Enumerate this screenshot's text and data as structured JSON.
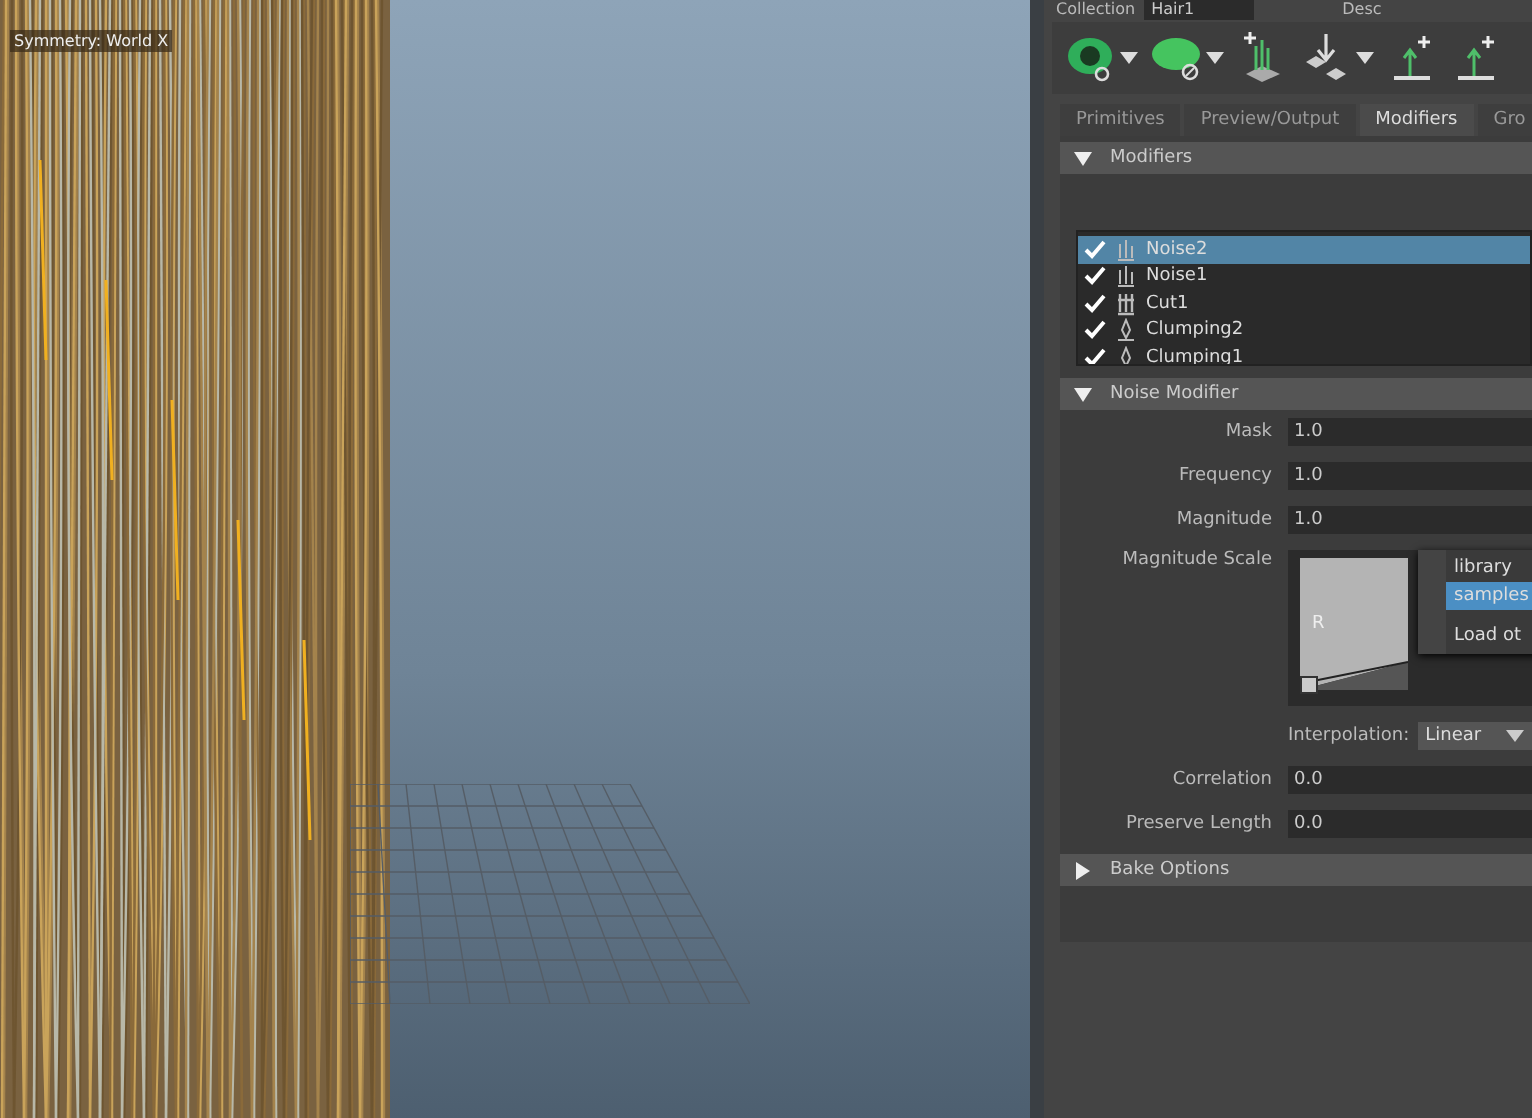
{
  "viewport": {
    "overlay_label": "Symmetry: World X"
  },
  "header": {
    "collection_label": "Collection",
    "collection_value": "Hair1",
    "description_label": "Desc"
  },
  "toolbar": {
    "tools": [
      {
        "kind": "eye",
        "dropdown": true
      },
      {
        "kind": "leaf",
        "dropdown": true
      },
      {
        "kind": "add-guides",
        "dropdown": false
      },
      {
        "kind": "move-guides",
        "dropdown": true
      },
      {
        "kind": "add-strand",
        "dropdown": false
      },
      {
        "kind": "add-strand",
        "dropdown": false
      }
    ]
  },
  "tabs": [
    {
      "label": "Primitives",
      "selected": false
    },
    {
      "label": "Preview/Output",
      "selected": false
    },
    {
      "label": "Modifiers",
      "selected": true
    },
    {
      "label": "Gro",
      "selected": false
    }
  ],
  "modifiers_section": {
    "title": "Modifiers",
    "expanded": true,
    "items": [
      {
        "label": "Noise2",
        "checked": true,
        "selected": true,
        "kind": "noise"
      },
      {
        "label": "Noise1",
        "checked": true,
        "selected": false,
        "kind": "noise"
      },
      {
        "label": "Cut1",
        "checked": true,
        "selected": false,
        "kind": "cut"
      },
      {
        "label": "Clumping2",
        "checked": true,
        "selected": false,
        "kind": "clump"
      },
      {
        "label": "Clumping1",
        "checked": true,
        "selected": false,
        "kind": "clump"
      }
    ]
  },
  "noise_section": {
    "title": "Noise Modifier",
    "expanded": true,
    "fields_top": [
      {
        "label": "Mask",
        "value": "1.0"
      },
      {
        "label": "Frequency",
        "value": "1.0"
      },
      {
        "label": "Magnitude",
        "value": "1.0"
      }
    ],
    "ramp": {
      "label": "Magnitude Scale",
      "channel": "R",
      "interpolation_label": "Interpolation:",
      "interpolation_value": "Linear"
    },
    "fields_bottom": [
      {
        "label": "Correlation",
        "value": "0.0"
      },
      {
        "label": "Preserve Length",
        "value": "0.0"
      }
    ]
  },
  "bake_section": {
    "title": "Bake Options",
    "expanded": false
  },
  "popup_menu": [
    {
      "label": "library",
      "selected": false
    },
    {
      "label": "samples",
      "selected": true
    },
    {
      "label": "Load ot",
      "selected": false
    }
  ]
}
